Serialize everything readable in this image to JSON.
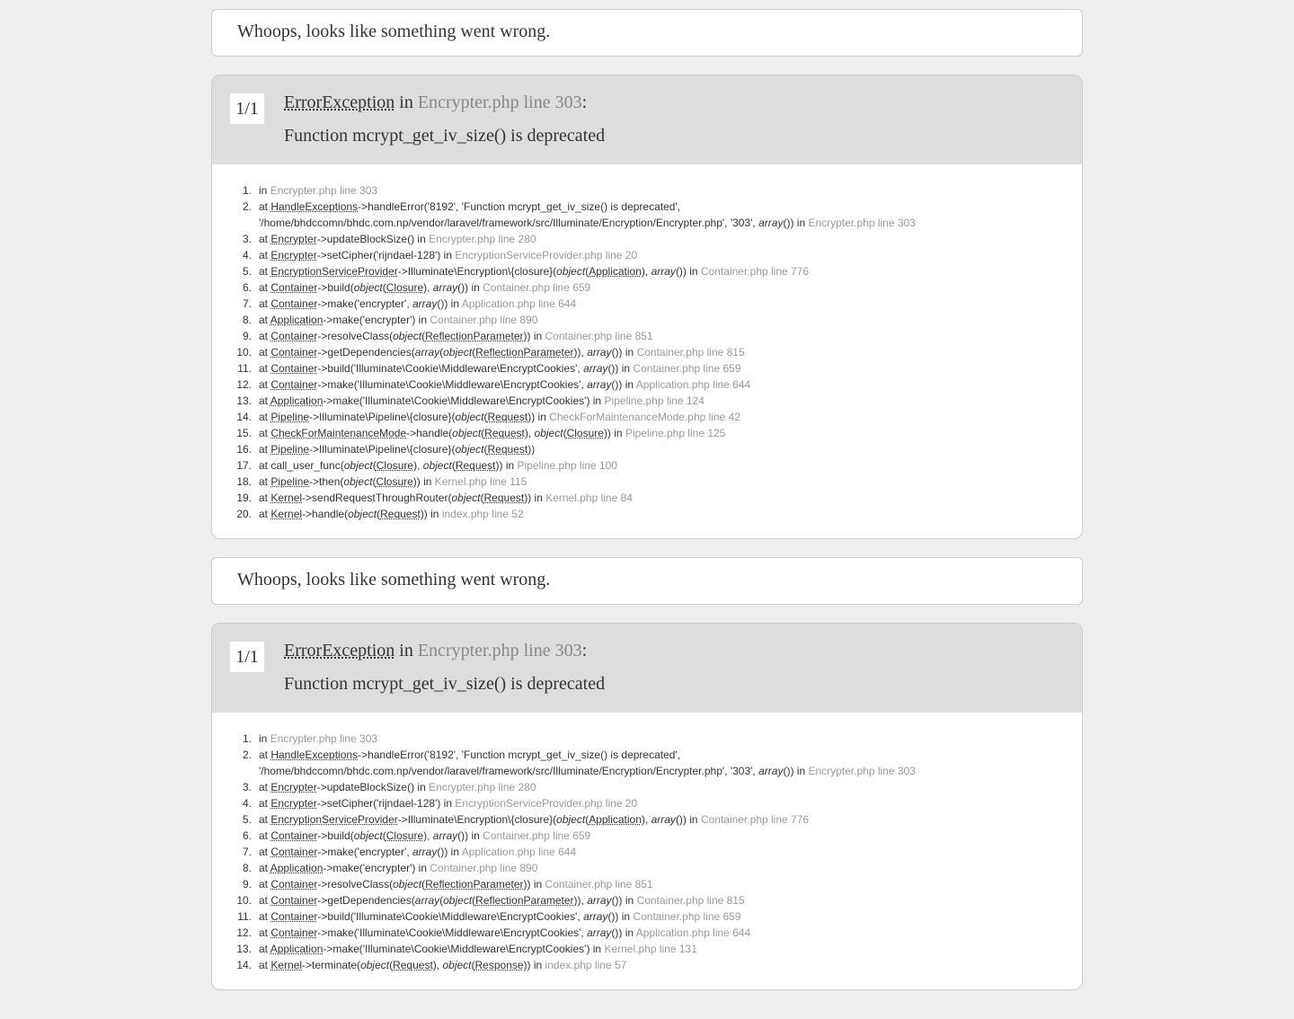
{
  "title": "Whoops, looks like something went wrong.",
  "blocks": [
    {
      "counter": "1/1",
      "exception_class": "ErrorException",
      "in_word": "in",
      "exception_file": "Encrypter.php line 303",
      "colon": ":",
      "message": "Function mcrypt_get_iv_size() is deprecated",
      "trace": [
        {
          "n": "1.",
          "parts": [
            {
              "t": "in "
            },
            {
              "f": "Encrypter.php line 303"
            }
          ]
        },
        {
          "n": "2.",
          "parts": [
            {
              "t": "at "
            },
            {
              "c": "HandleExceptions"
            },
            {
              "t": "->handleError('8192', 'Function mcrypt_get_iv_size() is deprecated', '/home/bhdccomn/bhdc.com.np/vendor/laravel/framework/src/Illuminate/Encryption/Encrypter.php', '303', "
            },
            {
              "o": "array"
            },
            {
              "t": "()) in "
            },
            {
              "f": "Encrypter.php line 303"
            }
          ],
          "wrap": true
        },
        {
          "n": "3.",
          "parts": [
            {
              "t": "at "
            },
            {
              "c": "Encrypter"
            },
            {
              "t": "->updateBlockSize() in "
            },
            {
              "f": "Encrypter.php line 280"
            }
          ]
        },
        {
          "n": "4.",
          "parts": [
            {
              "t": "at "
            },
            {
              "c": "Encrypter"
            },
            {
              "t": "->setCipher('rijndael-128') in "
            },
            {
              "f": "EncryptionServiceProvider.php line 20"
            }
          ]
        },
        {
          "n": "5.",
          "parts": [
            {
              "t": "at "
            },
            {
              "c": "EncryptionServiceProvider"
            },
            {
              "t": "->Illuminate\\Encryption\\{closure}("
            },
            {
              "o": "object"
            },
            {
              "t": "("
            },
            {
              "c": "Application"
            },
            {
              "t": "), "
            },
            {
              "o": "array"
            },
            {
              "t": "()) in "
            },
            {
              "f": "Container.php line 776"
            }
          ]
        },
        {
          "n": "6.",
          "parts": [
            {
              "t": "at "
            },
            {
              "c": "Container"
            },
            {
              "t": "->build("
            },
            {
              "o": "object"
            },
            {
              "t": "("
            },
            {
              "c": "Closure"
            },
            {
              "t": "), "
            },
            {
              "o": "array"
            },
            {
              "t": "()) in "
            },
            {
              "f": "Container.php line 659"
            }
          ]
        },
        {
          "n": "7.",
          "parts": [
            {
              "t": "at "
            },
            {
              "c": "Container"
            },
            {
              "t": "->make('encrypter', "
            },
            {
              "o": "array"
            },
            {
              "t": "()) in "
            },
            {
              "f": "Application.php line 644"
            }
          ]
        },
        {
          "n": "8.",
          "parts": [
            {
              "t": "at "
            },
            {
              "c": "Application"
            },
            {
              "t": "->make('encrypter') in "
            },
            {
              "f": "Container.php line 890"
            }
          ]
        },
        {
          "n": "9.",
          "parts": [
            {
              "t": "at "
            },
            {
              "c": "Container"
            },
            {
              "t": "->resolveClass("
            },
            {
              "o": "object"
            },
            {
              "t": "("
            },
            {
              "c": "ReflectionParameter"
            },
            {
              "t": ")) in "
            },
            {
              "f": "Container.php line 851"
            }
          ]
        },
        {
          "n": "10.",
          "parts": [
            {
              "t": "at "
            },
            {
              "c": "Container"
            },
            {
              "t": "->getDependencies("
            },
            {
              "o": "array"
            },
            {
              "t": "("
            },
            {
              "o": "object"
            },
            {
              "t": "("
            },
            {
              "c": "ReflectionParameter"
            },
            {
              "t": ")), "
            },
            {
              "o": "array"
            },
            {
              "t": "()) in "
            },
            {
              "f": "Container.php line 815"
            }
          ]
        },
        {
          "n": "11.",
          "parts": [
            {
              "t": "at "
            },
            {
              "c": "Container"
            },
            {
              "t": "->build('Illuminate\\Cookie\\Middleware\\EncryptCookies', "
            },
            {
              "o": "array"
            },
            {
              "t": "()) in "
            },
            {
              "f": "Container.php line 659"
            }
          ]
        },
        {
          "n": "12.",
          "parts": [
            {
              "t": "at "
            },
            {
              "c": "Container"
            },
            {
              "t": "->make('Illuminate\\Cookie\\Middleware\\EncryptCookies', "
            },
            {
              "o": "array"
            },
            {
              "t": "()) in "
            },
            {
              "f": "Application.php line 644"
            }
          ]
        },
        {
          "n": "13.",
          "parts": [
            {
              "t": "at "
            },
            {
              "c": "Application"
            },
            {
              "t": "->make('Illuminate\\Cookie\\Middleware\\EncryptCookies') in "
            },
            {
              "f": "Pipeline.php line 124"
            }
          ]
        },
        {
          "n": "14.",
          "parts": [
            {
              "t": "at "
            },
            {
              "c": "Pipeline"
            },
            {
              "t": "->Illuminate\\Pipeline\\{closure}("
            },
            {
              "o": "object"
            },
            {
              "t": "("
            },
            {
              "c": "Request"
            },
            {
              "t": ")) in "
            },
            {
              "f": "CheckForMaintenanceMode.php line 42"
            }
          ]
        },
        {
          "n": "15.",
          "parts": [
            {
              "t": "at "
            },
            {
              "c": "CheckForMaintenanceMode"
            },
            {
              "t": "->handle("
            },
            {
              "o": "object"
            },
            {
              "t": "("
            },
            {
              "c": "Request"
            },
            {
              "t": "), "
            },
            {
              "o": "object"
            },
            {
              "t": "("
            },
            {
              "c": "Closure"
            },
            {
              "t": ")) in "
            },
            {
              "f": "Pipeline.php line 125"
            }
          ]
        },
        {
          "n": "16.",
          "parts": [
            {
              "t": "at "
            },
            {
              "c": "Pipeline"
            },
            {
              "t": "->Illuminate\\Pipeline\\{closure}("
            },
            {
              "o": "object"
            },
            {
              "t": "("
            },
            {
              "c": "Request"
            },
            {
              "t": "))"
            }
          ]
        },
        {
          "n": "17.",
          "parts": [
            {
              "t": "at call_user_func("
            },
            {
              "o": "object"
            },
            {
              "t": "("
            },
            {
              "c": "Closure"
            },
            {
              "t": "), "
            },
            {
              "o": "object"
            },
            {
              "t": "("
            },
            {
              "c": "Request"
            },
            {
              "t": ")) in "
            },
            {
              "f": "Pipeline.php line 100"
            }
          ]
        },
        {
          "n": "18.",
          "parts": [
            {
              "t": "at "
            },
            {
              "c": "Pipeline"
            },
            {
              "t": "->then("
            },
            {
              "o": "object"
            },
            {
              "t": "("
            },
            {
              "c": "Closure"
            },
            {
              "t": ")) in "
            },
            {
              "f": "Kernel.php line 115"
            }
          ]
        },
        {
          "n": "19.",
          "parts": [
            {
              "t": "at "
            },
            {
              "c": "Kernel"
            },
            {
              "t": "->sendRequestThroughRouter("
            },
            {
              "o": "object"
            },
            {
              "t": "("
            },
            {
              "c": "Request"
            },
            {
              "t": ")) in "
            },
            {
              "f": "Kernel.php line 84"
            }
          ]
        },
        {
          "n": "20.",
          "parts": [
            {
              "t": "at "
            },
            {
              "c": "Kernel"
            },
            {
              "t": "->handle("
            },
            {
              "o": "object"
            },
            {
              "t": "("
            },
            {
              "c": "Request"
            },
            {
              "t": ")) in "
            },
            {
              "f": "index.php line 52"
            }
          ]
        }
      ]
    },
    {
      "counter": "1/1",
      "exception_class": "ErrorException",
      "in_word": "in",
      "exception_file": "Encrypter.php line 303",
      "colon": ":",
      "message": "Function mcrypt_get_iv_size() is deprecated",
      "trace": [
        {
          "n": "1.",
          "parts": [
            {
              "t": "in "
            },
            {
              "f": "Encrypter.php line 303"
            }
          ]
        },
        {
          "n": "2.",
          "parts": [
            {
              "t": "at "
            },
            {
              "c": "HandleExceptions"
            },
            {
              "t": "->handleError('8192', 'Function mcrypt_get_iv_size() is deprecated', '/home/bhdccomn/bhdc.com.np/vendor/laravel/framework/src/Illuminate/Encryption/Encrypter.php', '303', "
            },
            {
              "o": "array"
            },
            {
              "t": "()) in "
            },
            {
              "f": "Encrypter.php line 303"
            }
          ],
          "wrap": true
        },
        {
          "n": "3.",
          "parts": [
            {
              "t": "at "
            },
            {
              "c": "Encrypter"
            },
            {
              "t": "->updateBlockSize() in "
            },
            {
              "f": "Encrypter.php line 280"
            }
          ]
        },
        {
          "n": "4.",
          "parts": [
            {
              "t": "at "
            },
            {
              "c": "Encrypter"
            },
            {
              "t": "->setCipher('rijndael-128') in "
            },
            {
              "f": "EncryptionServiceProvider.php line 20"
            }
          ]
        },
        {
          "n": "5.",
          "parts": [
            {
              "t": "at "
            },
            {
              "c": "EncryptionServiceProvider"
            },
            {
              "t": "->Illuminate\\Encryption\\{closure}("
            },
            {
              "o": "object"
            },
            {
              "t": "("
            },
            {
              "c": "Application"
            },
            {
              "t": "), "
            },
            {
              "o": "array"
            },
            {
              "t": "()) in "
            },
            {
              "f": "Container.php line 776"
            }
          ]
        },
        {
          "n": "6.",
          "parts": [
            {
              "t": "at "
            },
            {
              "c": "Container"
            },
            {
              "t": "->build("
            },
            {
              "o": "object"
            },
            {
              "t": "("
            },
            {
              "c": "Closure"
            },
            {
              "t": "), "
            },
            {
              "o": "array"
            },
            {
              "t": "()) in "
            },
            {
              "f": "Container.php line 659"
            }
          ]
        },
        {
          "n": "7.",
          "parts": [
            {
              "t": "at "
            },
            {
              "c": "Container"
            },
            {
              "t": "->make('encrypter', "
            },
            {
              "o": "array"
            },
            {
              "t": "()) in "
            },
            {
              "f": "Application.php line 644"
            }
          ]
        },
        {
          "n": "8.",
          "parts": [
            {
              "t": "at "
            },
            {
              "c": "Application"
            },
            {
              "t": "->make('encrypter') in "
            },
            {
              "f": "Container.php line 890"
            }
          ]
        },
        {
          "n": "9.",
          "parts": [
            {
              "t": "at "
            },
            {
              "c": "Container"
            },
            {
              "t": "->resolveClass("
            },
            {
              "o": "object"
            },
            {
              "t": "("
            },
            {
              "c": "ReflectionParameter"
            },
            {
              "t": ")) in "
            },
            {
              "f": "Container.php line 851"
            }
          ]
        },
        {
          "n": "10.",
          "parts": [
            {
              "t": "at "
            },
            {
              "c": "Container"
            },
            {
              "t": "->getDependencies("
            },
            {
              "o": "array"
            },
            {
              "t": "("
            },
            {
              "o": "object"
            },
            {
              "t": "("
            },
            {
              "c": "ReflectionParameter"
            },
            {
              "t": ")), "
            },
            {
              "o": "array"
            },
            {
              "t": "()) in "
            },
            {
              "f": "Container.php line 815"
            }
          ]
        },
        {
          "n": "11.",
          "parts": [
            {
              "t": "at "
            },
            {
              "c": "Container"
            },
            {
              "t": "->build('Illuminate\\Cookie\\Middleware\\EncryptCookies', "
            },
            {
              "o": "array"
            },
            {
              "t": "()) in "
            },
            {
              "f": "Container.php line 659"
            }
          ]
        },
        {
          "n": "12.",
          "parts": [
            {
              "t": "at "
            },
            {
              "c": "Container"
            },
            {
              "t": "->make('Illuminate\\Cookie\\Middleware\\EncryptCookies', "
            },
            {
              "o": "array"
            },
            {
              "t": "()) in "
            },
            {
              "f": "Application.php line 644"
            }
          ]
        },
        {
          "n": "13.",
          "parts": [
            {
              "t": "at "
            },
            {
              "c": "Application"
            },
            {
              "t": "->make('Illuminate\\Cookie\\Middleware\\EncryptCookies') in "
            },
            {
              "f": "Kernel.php line 131"
            }
          ]
        },
        {
          "n": "14.",
          "parts": [
            {
              "t": "at "
            },
            {
              "c": "Kernel"
            },
            {
              "t": "->terminate("
            },
            {
              "o": "object"
            },
            {
              "t": "("
            },
            {
              "c": "Request"
            },
            {
              "t": "), "
            },
            {
              "o": "object"
            },
            {
              "t": "("
            },
            {
              "c": "Response"
            },
            {
              "t": ")) in "
            },
            {
              "f": "index.php line 57"
            }
          ]
        }
      ]
    }
  ]
}
